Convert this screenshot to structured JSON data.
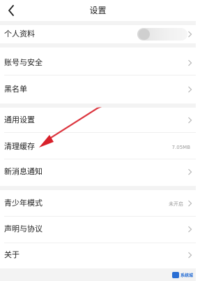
{
  "header": {
    "title": "设置"
  },
  "rows": {
    "profile": {
      "label": "个人资料"
    },
    "account": {
      "label": "账号与安全"
    },
    "blacklist": {
      "label": "黑名单"
    },
    "general": {
      "label": "通用设置"
    },
    "cache": {
      "label": "清理缓存",
      "value": "7.05MB"
    },
    "notify": {
      "label": "新消息通知"
    },
    "teen": {
      "label": "青少年模式",
      "value": "未开启"
    },
    "terms": {
      "label": "声明与协议"
    },
    "about": {
      "label": "关于"
    }
  },
  "annotation": {
    "arrow_color": "#d8202a"
  },
  "watermark": {
    "text": "系统城"
  }
}
